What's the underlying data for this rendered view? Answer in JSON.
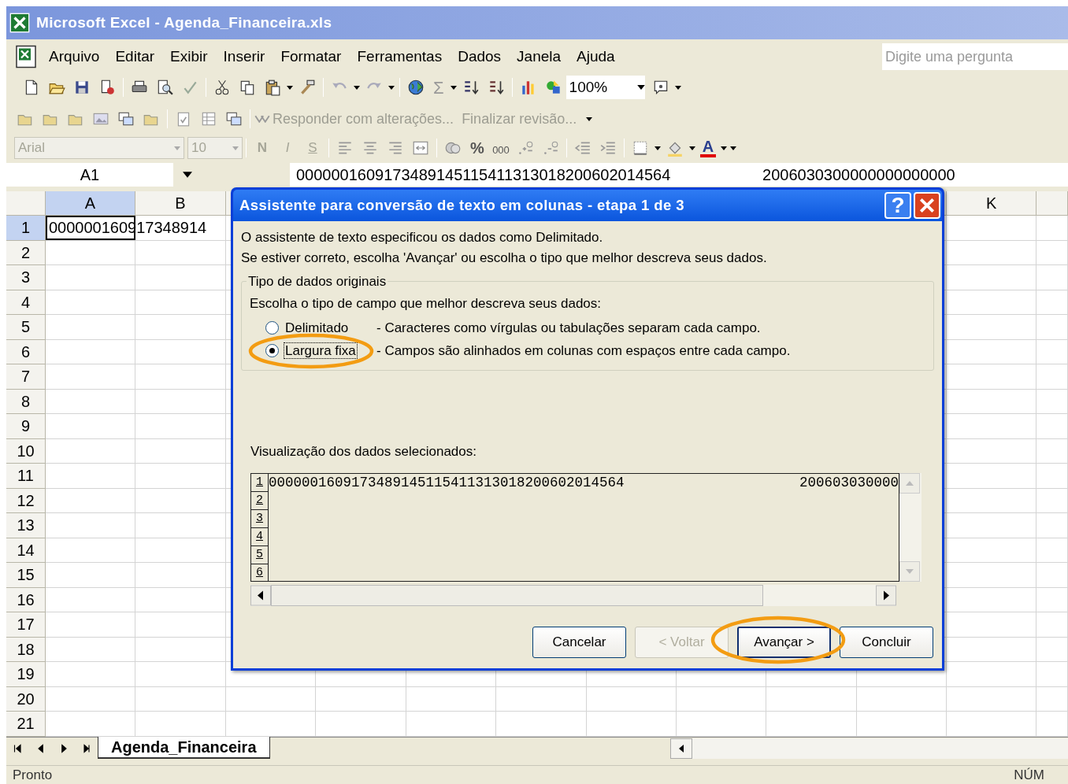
{
  "window": {
    "title": "Microsoft Excel - Agenda_Financeira.xls"
  },
  "menu": [
    "Arquivo",
    "Editar",
    "Exibir",
    "Inserir",
    "Formatar",
    "Ferramentas",
    "Dados",
    "Janela",
    "Ajuda"
  ],
  "question_box": {
    "placeholder": "Digite uma pergunta"
  },
  "standard_toolbar": {
    "sum": "Σ",
    "zoom": "100%"
  },
  "review_toolbar": {
    "buttons": [
      {
        "label": "Responder com alterações...",
        "disabled": true
      },
      {
        "label": "Finalizar revisão...",
        "disabled": true
      }
    ]
  },
  "formatting_toolbar": {
    "disabled": true,
    "font": "Arial",
    "size": "10",
    "bold": "N",
    "italic": "I",
    "underline": "S",
    "percent": "%",
    "thousands": "000",
    "font_color": "A"
  },
  "formula_bar": {
    "name_box": "A1",
    "content": "0000001609173489145115411313018200602014564                     2006030300000000000000"
  },
  "columns": [
    {
      "label": "A",
      "selected": true
    },
    {
      "label": "B",
      "selected": false
    },
    {
      "label": "K",
      "selected": false
    }
  ],
  "rows": [
    {
      "label": "1",
      "selected": true,
      "cells": [
        {
          "text": "000000160917348914",
          "active": true
        }
      ]
    },
    {
      "label": "2",
      "selected": false
    },
    {
      "label": "3",
      "selected": false
    },
    {
      "label": "4",
      "selected": false
    },
    {
      "label": "5",
      "selected": false
    },
    {
      "label": "6",
      "selected": false
    },
    {
      "label": "7",
      "selected": false
    },
    {
      "label": "8",
      "selected": false
    },
    {
      "label": "9",
      "selected": false
    },
    {
      "label": "10",
      "selected": false
    },
    {
      "label": "11",
      "selected": false
    },
    {
      "label": "12",
      "selected": false
    },
    {
      "label": "13",
      "selected": false
    },
    {
      "label": "14",
      "selected": false
    },
    {
      "label": "15",
      "selected": false
    },
    {
      "label": "16",
      "selected": false
    },
    {
      "label": "17",
      "selected": false
    },
    {
      "label": "18",
      "selected": false
    },
    {
      "label": "19",
      "selected": false
    },
    {
      "label": "20",
      "selected": false
    },
    {
      "label": "21",
      "selected": false
    }
  ],
  "sheet_tabs": [
    {
      "label": "Agenda_Financeira",
      "selected": true
    }
  ],
  "status_bar": {
    "left": "Pronto",
    "right": "NÚM"
  },
  "dialog": {
    "title": "Assistente para conversão de texto em colunas - etapa 1 de 3",
    "help_button": "?",
    "intro": [
      "O assistente de texto especificou os dados como Delimitado.",
      "Se estiver correto, escolha 'Avançar' ou escolha o tipo que melhor descreva seus dados."
    ],
    "group": {
      "legend": "Tipo de dados originais",
      "prompt": "Escolha o tipo de campo que melhor descreva seus dados:",
      "options": [
        {
          "label": "Delimitado",
          "description": "- Caracteres como vírgulas ou tabulações separam cada campo.",
          "selected": false,
          "circled": false
        },
        {
          "label": "Largura fixa",
          "description": "- Campos são alinhados em colunas com espaços entre cada campo.",
          "selected": true,
          "circled": true
        }
      ]
    },
    "preview": {
      "label": "Visualização dos dados selecionados:",
      "rows": [
        {
          "number": "1",
          "text": "0000001609173489145115411313018200602014564",
          "text_end": "200603030000"
        },
        {
          "number": "2"
        },
        {
          "number": "3"
        },
        {
          "number": "4"
        },
        {
          "number": "5"
        },
        {
          "number": "6"
        }
      ]
    },
    "buttons": [
      {
        "label": "Cancelar",
        "disabled": false,
        "default": false,
        "circled": false
      },
      {
        "label": "< Voltar",
        "disabled": true,
        "default": false,
        "circled": false
      },
      {
        "label": "Avançar >",
        "disabled": false,
        "default": true,
        "circled": true
      },
      {
        "label": "Concluir",
        "disabled": false,
        "default": false,
        "circled": false
      }
    ]
  }
}
